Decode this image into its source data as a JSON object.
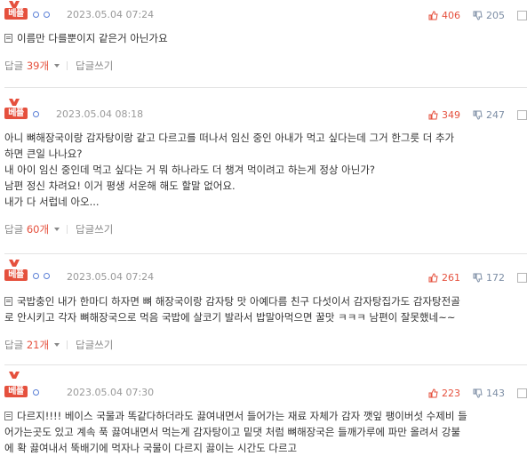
{
  "comments": [
    {
      "best_badge": "베플",
      "date": "2023.05.04 07:24",
      "likes": "406",
      "dislikes": "205",
      "text": "이름만 다를뿐이지 같은거 아닌가요",
      "reply_label": "답글",
      "reply_count": "39개",
      "write_reply": "답글쓰기"
    },
    {
      "best_badge": "베플",
      "date": "2023.05.04 08:18",
      "likes": "349",
      "dislikes": "247",
      "text_lines": [
        "아니 뼈해장국이랑 감자탕이랑 같고 다르고를 떠나서 임신 중인 아내가 먹고 싶다는데 그거 한그릇 더 추가",
        "하면 큰일 나나요?",
        "내 아이 임신 중인데 먹고 싶다는 거 뭐 하나라도 더 챙겨 먹이려고 하는게 정상 아닌가?",
        "남편 정신 차려요! 이거 평생 서운해 해도 할말 없어요.",
        "내가 다 서럽네 아오..."
      ],
      "reply_label": "답글",
      "reply_count": "60개",
      "write_reply": "답글쓰기"
    },
    {
      "best_badge": "베플",
      "date": "2023.05.04 07:24",
      "likes": "261",
      "dislikes": "172",
      "text_lines": [
        "국밥충인 내가 한마디 하자면 뼈 해장국이랑 감자탕 맛 아예다름 친구 다섯이서 감자탕집가도 감자탕전골",
        "로 안시키고 각자 뼈해장국으로 먹음 국밥에 살코기 발라서 밥말아먹으면 꿀맛 ㅋㅋㅋ 남편이 잘못했네~~"
      ],
      "reply_label": "답글",
      "reply_count": "21개",
      "write_reply": "답글쓰기"
    },
    {
      "best_badge": "베플",
      "date": "2023.05.04 07:30",
      "likes": "223",
      "dislikes": "143",
      "text_lines": [
        "다르지!!!! 베이스 국물과 똑같다하더라도 끓여내면서 들어가는 재료 자체가 감자 깻잎 팽이버섯 수제비 들",
        "어가는곳도 있고 계속 푹 끓여내면서 먹는게 감자탕이고 밑댓 처럼 뼈해장국은 들깨가루에 파만 올려서 강불",
        "에 확 끓여내서 뚝배기에 먹자나 국물이 다르지 끓이는 시간도 다르고"
      ]
    }
  ],
  "colors": {
    "accent_red": "#e5503d",
    "dislike_gray_blue": "#7d8ea5",
    "level_blue": "#5a7fd6"
  },
  "icons": {
    "medal": "medal-icon",
    "like": "thumbs-up-icon",
    "dislike": "thumbs-down-icon",
    "report": "report-icon",
    "doc": "document-icon",
    "dropdown": "caret-down-icon"
  }
}
